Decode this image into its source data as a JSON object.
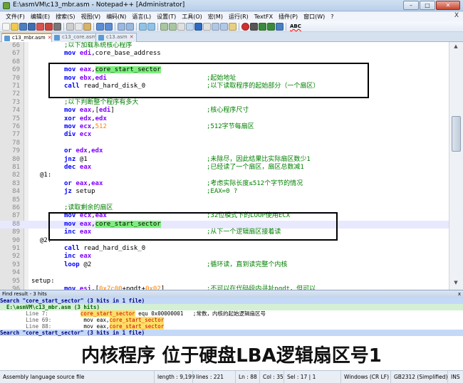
{
  "window": {
    "title": "E:\\asmVM\\c13_mbr.asm - Notepad++ [Administrator]",
    "minimize": "–",
    "maximize": "□",
    "close": "✕"
  },
  "menu": [
    "文件(F)",
    "编辑(E)",
    "搜索(S)",
    "视图(V)",
    "编码(N)",
    "语言(L)",
    "设置(T)",
    "工具(O)",
    "宏(M)",
    "运行(R)",
    "TextFX",
    "插件(P)",
    "窗口(W)",
    "?"
  ],
  "menu_close": "X",
  "toolbar_abc": "ABC",
  "tabs": [
    {
      "label": "c13_mbr.asm",
      "active": true
    },
    {
      "label": "c13_core.asm",
      "active": false
    },
    {
      "label": "c13.asm",
      "active": false
    }
  ],
  "colors": {
    "keyword": "#0000ff",
    "register": "#8000ff",
    "comment": "#008000",
    "number": "#ff8000",
    "match_highlight": "#7cf07c"
  },
  "code_lines": [
    {
      "n": "66",
      "full_comment": ";以下加载系统核心程序"
    },
    {
      "n": "67",
      "ins": "mov",
      "ops": [
        {
          "t": " edi",
          "c": "reg"
        },
        {
          "t": ",core_base_address"
        }
      ]
    },
    {
      "n": "68"
    },
    {
      "n": "69",
      "ins": "mov",
      "ops": [
        {
          "t": " eax",
          "c": "reg"
        },
        {
          "t": ","
        },
        {
          "t": "core_start_sector",
          "c": "hl"
        }
      ]
    },
    {
      "n": "70",
      "ins": "mov",
      "ops": [
        {
          "t": " ebx",
          "c": "reg"
        },
        {
          "t": ","
        },
        {
          "t": "edi",
          "c": "reg"
        }
      ],
      "cmt": ";起始地址"
    },
    {
      "n": "71",
      "ins": "call",
      "ops": [
        {
          "t": " read_hard_disk_0"
        }
      ],
      "cmt": ";以下读取程序的起始部分（一个扇区）"
    },
    {
      "n": "72"
    },
    {
      "n": "73",
      "full_comment": ";以下判断整个程序有多大"
    },
    {
      "n": "74",
      "ins": "mov",
      "ops": [
        {
          "t": " eax",
          "c": "reg"
        },
        {
          "t": ",["
        },
        {
          "t": "edi",
          "c": "reg"
        },
        {
          "t": "]"
        }
      ],
      "cmt": ";核心程序尺寸"
    },
    {
      "n": "75",
      "ins": "xor",
      "ops": [
        {
          "t": " edx",
          "c": "reg"
        },
        {
          "t": ","
        },
        {
          "t": "edx",
          "c": "reg"
        }
      ]
    },
    {
      "n": "76",
      "ins": "mov",
      "ops": [
        {
          "t": " ecx",
          "c": "reg"
        },
        {
          "t": ","
        },
        {
          "t": "512",
          "c": "num"
        }
      ],
      "cmt": ";512字节每扇区"
    },
    {
      "n": "77",
      "ins": "div",
      "ops": [
        {
          "t": " ecx",
          "c": "reg"
        }
      ]
    },
    {
      "n": "78"
    },
    {
      "n": "79",
      "ins": "or",
      "ops": [
        {
          "t": " edx",
          "c": "reg"
        },
        {
          "t": ","
        },
        {
          "t": "edx",
          "c": "reg"
        }
      ]
    },
    {
      "n": "80",
      "ins": "jnz",
      "ops": [
        {
          "t": " @1"
        }
      ],
      "cmt": ";未除尽，因此结果比实际扇区数少1"
    },
    {
      "n": "81",
      "ins": "dec",
      "ops": [
        {
          "t": " eax",
          "c": "reg"
        }
      ],
      "cmt": ";已经读了一个扇区，扇区总数减1"
    },
    {
      "n": "82",
      "label": "@1:"
    },
    {
      "n": "83",
      "ins": "or",
      "ops": [
        {
          "t": " eax",
          "c": "reg"
        },
        {
          "t": ","
        },
        {
          "t": "eax",
          "c": "reg"
        }
      ],
      "cmt": ";考虑实际长度≤512个字节的情况"
    },
    {
      "n": "84",
      "ins": "jz",
      "ops": [
        {
          "t": " setup"
        }
      ],
      "cmt": ";EAX=0 ?"
    },
    {
      "n": "85"
    },
    {
      "n": "86",
      "full_comment": ";读取剩余的扇区"
    },
    {
      "n": "87",
      "ins": "mov",
      "ops": [
        {
          "t": " ecx",
          "c": "reg"
        },
        {
          "t": ","
        },
        {
          "t": "eax",
          "c": "reg"
        }
      ],
      "cmt": ";32位模式下的LOOP使用ECX"
    },
    {
      "n": "88",
      "ins": "mov",
      "ops": [
        {
          "t": " eax",
          "c": "reg"
        },
        {
          "t": ","
        },
        {
          "t": "core_start_sector",
          "c": "hl"
        }
      ],
      "current": true
    },
    {
      "n": "89",
      "ins": "inc",
      "ops": [
        {
          "t": " eax",
          "c": "reg"
        }
      ],
      "cmt": ";从下一个逻辑扇区接着读"
    },
    {
      "n": "90",
      "label": "@2:"
    },
    {
      "n": "91",
      "ins": "call",
      "ops": [
        {
          "t": " read_hard_disk_0"
        }
      ]
    },
    {
      "n": "92",
      "ins": "inc",
      "ops": [
        {
          "t": " eax",
          "c": "reg"
        }
      ]
    },
    {
      "n": "93",
      "ins": "loop",
      "ops": [
        {
          "t": " @2"
        }
      ],
      "cmt": ";循环读，直到读完整个内核"
    },
    {
      "n": "94"
    },
    {
      "n": "95",
      "label": "setup:",
      "outdent": true
    },
    {
      "n": "96",
      "ins": "mov",
      "ops": [
        {
          "t": " esi",
          "c": "reg"
        },
        {
          "t": ",["
        },
        {
          "t": "0x7c00",
          "c": "num"
        },
        {
          "t": "+pgdt+"
        },
        {
          "t": "0x02",
          "c": "num"
        },
        {
          "t": "]"
        }
      ],
      "cmt": ";不可以在代码段内寻址pgdt，但可以"
    }
  ],
  "find": {
    "header": "Find result - 3 hits",
    "close": "x",
    "lines": [
      {
        "type": "search",
        "text": "Search \"core_start_sector\" (3 hits in 1 file)"
      },
      {
        "type": "file",
        "text": "  E:\\asmVM\\c13_mbr.asm (3 hits)"
      },
      {
        "type": "match",
        "ln": "\tLine 7:",
        "pre": "          ",
        "hit": "core_start_sector",
        "post": " equ 0x00000001   ;常数，内核的起始逻辑扇区号"
      },
      {
        "type": "match",
        "ln": "\tLine 69:",
        "pre": "          mov eax,",
        "hit": "core_start_sector",
        "post": ""
      },
      {
        "type": "match",
        "ln": "\tLine 88:",
        "pre": "          mov eax,",
        "hit": "core_start_sector",
        "post": ""
      },
      {
        "type": "search",
        "text": "Search \"core_start_sector\" (3 hits in 1 file)"
      }
    ]
  },
  "caption": "内核程序 位于硬盘LBA逻辑扇区号1",
  "status": {
    "type": "Assembly language source file",
    "length": "length : 9,199",
    "lines": "lines : 221",
    "ln": "Ln : 88",
    "col": "Col : 35",
    "sel": "Sel : 17 | 1",
    "eol": "Windows (CR LF)",
    "encoding": "GB2312 (Simplified)",
    "mode": "INS"
  }
}
